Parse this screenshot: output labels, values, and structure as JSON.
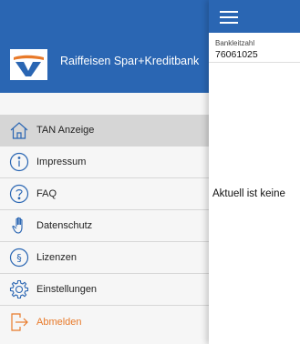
{
  "drawer": {
    "bank_name": "Raiffeisen Spar+Kreditbank",
    "items": [
      {
        "label": "TAN Anzeige",
        "icon": "home-icon",
        "active": true
      },
      {
        "label": "Impressum",
        "icon": "info-icon"
      },
      {
        "label": "FAQ",
        "icon": "question-icon"
      },
      {
        "label": "Datenschutz",
        "icon": "hand-icon"
      },
      {
        "label": "Lizenzen",
        "icon": "paragraph-icon"
      },
      {
        "label": "Einstellungen",
        "icon": "gear-icon"
      },
      {
        "label": "Abmelden",
        "icon": "logout-icon"
      }
    ]
  },
  "content": {
    "blz_label": "Bankleitzahl",
    "blz_value": "76061025",
    "status_text": "Aktuell ist keine"
  },
  "colors": {
    "brand_blue": "#2a66b3",
    "brand_orange": "#e87a2a",
    "active_row": "#d6d6d6"
  }
}
